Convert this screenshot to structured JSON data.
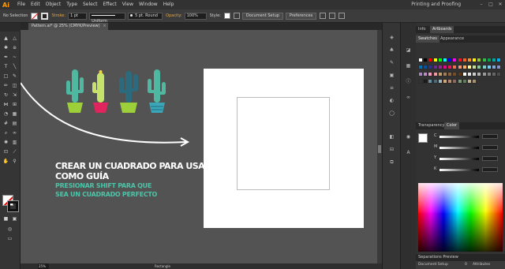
{
  "app": {
    "logo": "Ai",
    "menu": [
      "File",
      "Edit",
      "Object",
      "Type",
      "Select",
      "Effect",
      "View",
      "Window",
      "Help"
    ],
    "workspace": "Printing and Proofing",
    "window_buttons": [
      "–",
      "□",
      "✕"
    ]
  },
  "control_bar": {
    "selection": "No Selection",
    "stroke_label": "Stroke:",
    "stroke_weight": "1 pt",
    "profile": "Uniform",
    "brush": "5 pt. Round",
    "opacity_label": "Opacity:",
    "opacity_value": "100%",
    "style_label": "Style:",
    "document_setup": "Document Setup",
    "preferences": "Preferences"
  },
  "document": {
    "tab_title": "Pattern.ai* @ 25% (CMYK/Preview)",
    "tab_close": "×"
  },
  "canvas": {
    "instruction_line1": "CREAR UN CUADRADO PARA USAR",
    "instruction_line2": "COMO GUÍA",
    "sub_line1": "PRESIONAR SHIFT PARA QUE",
    "sub_line2": "SEA UN CUADRADO PERFECTO",
    "colors": {
      "canvas_bg": "#535353",
      "artboard": "#ffffff",
      "teal_text": "#4dc3a7",
      "cactus_green": "#4fb8a0",
      "cactus_dark": "#2c6b7e",
      "pot_red": "#e0245e",
      "pot_green": "#9ccf3a",
      "pot_teal": "#3aa6b8"
    }
  },
  "status_bar": {
    "zoom": "25%",
    "current_tool": "Rectangle"
  },
  "right_panels": {
    "top_tabs": [
      "Info",
      "Artboards"
    ],
    "swatch_tabs": [
      "Swatches",
      "Appearance"
    ],
    "color_tabs": [
      "Transparency",
      "Color"
    ],
    "color_labels": [
      "C",
      "M",
      "Y",
      "K"
    ],
    "separations_tab": "Separations Preview",
    "separations_footer_left": "Document Setup",
    "separations_footer_mid": "0",
    "separations_footer_right": "Attributes"
  },
  "swatches": [
    "#ffffff",
    "#000000",
    "#ff0000",
    "#ffff00",
    "#00ff00",
    "#00ffff",
    "#0000ff",
    "#ff00ff",
    "#ed1c24",
    "#f26522",
    "#f7941d",
    "#fff200",
    "#8dc63f",
    "#39b54a",
    "#00a651",
    "#00a99d",
    "#00aeef",
    "#0072bc",
    "#0054a6",
    "#2e3192",
    "#662d91",
    "#92278f",
    "#ec008c",
    "#ed145b",
    "#f26c4f",
    "#f69679",
    "#fbaf5d",
    "#fff799",
    "#c4df9b",
    "#82ca9c",
    "#7accc8",
    "#6dcff6",
    "#7da7d9",
    "#8393ca",
    "#a187be",
    "#bd8cbf",
    "#f49ac1",
    "#f5989d",
    "#c69c6d",
    "#a67c52",
    "#8c6239",
    "#754c24",
    "#603913",
    "#ffffff",
    "#e6e6e6",
    "#cccccc",
    "#b3b3b3",
    "#999999",
    "#808080",
    "#666666",
    "#4d4d4d",
    "#333333",
    "#1a1a1a",
    "#6b8e9f",
    "#4a6d7c",
    "#9db7c2",
    "#d4a574",
    "#b8866b",
    "#8e6a5b",
    "#7a9b76",
    "#5f7d5b",
    "#c9b28f",
    "#a89070"
  ]
}
